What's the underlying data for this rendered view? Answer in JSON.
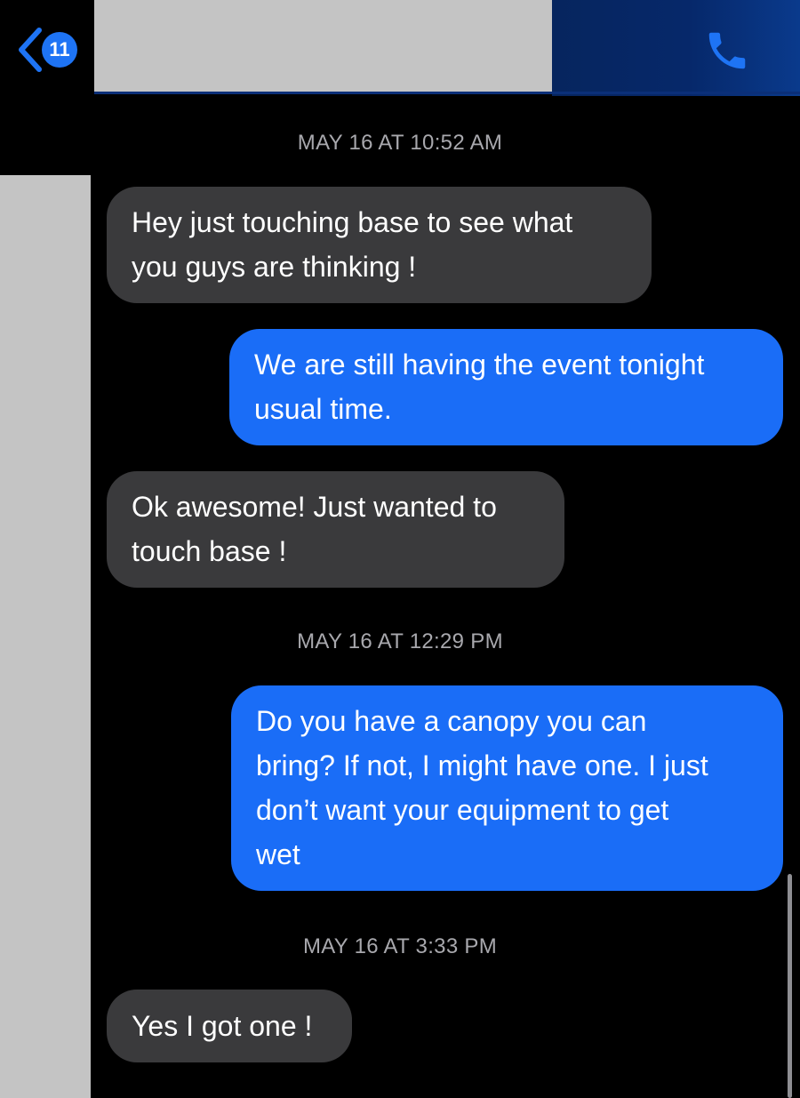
{
  "header": {
    "back_badge_count": "11",
    "back_icon": "chevron-left-icon",
    "call_icon": "phone-icon",
    "accent": "#1e74f5"
  },
  "messages": [
    {
      "type": "timestamp",
      "text": "MAY 16 AT 10:52 AM"
    },
    {
      "type": "incoming",
      "lines": [
        "Hey just touching base to see what",
        "you guys are thinking !"
      ]
    },
    {
      "type": "outgoing",
      "lines": [
        "We are still having the event tonight",
        "usual time."
      ]
    },
    {
      "type": "incoming",
      "lines": [
        "Ok awesome! Just wanted to",
        "touch base !"
      ]
    },
    {
      "type": "timestamp",
      "text": "MAY 16 AT 12:29 PM"
    },
    {
      "type": "outgoing",
      "lines": [
        "Do you have a canopy you can",
        "bring? If not, I might have one. I just",
        "don’t want your equipment to get",
        "wet"
      ]
    },
    {
      "type": "timestamp",
      "text": "MAY 16 AT 3:33 PM"
    },
    {
      "type": "incoming",
      "lines": [
        "Yes I got one !"
      ]
    }
  ],
  "colors": {
    "incoming_bubble": "#3a3a3c",
    "outgoing_bubble": "#1a6df7",
    "timestamp_text": "#a8a8ad",
    "background": "#000000"
  }
}
